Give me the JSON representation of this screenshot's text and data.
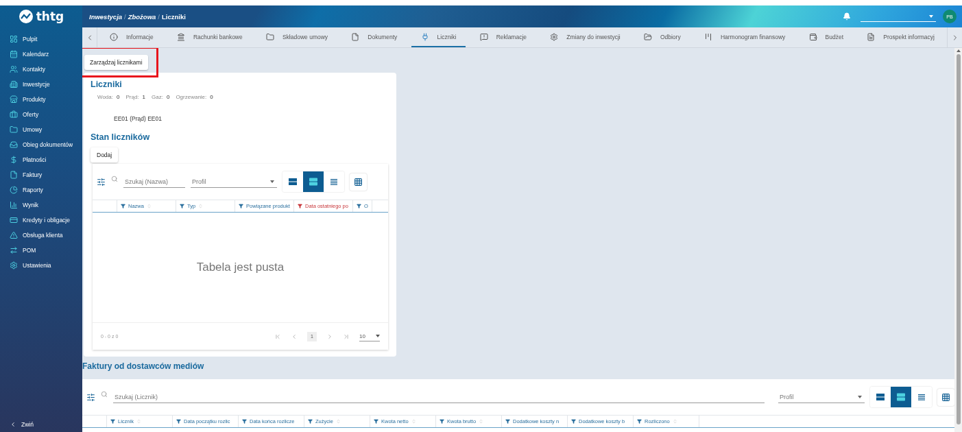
{
  "sidebar": {
    "logo": "thtg",
    "items": [
      {
        "label": "Pulpit"
      },
      {
        "label": "Kalendarz"
      },
      {
        "label": "Kontakty"
      },
      {
        "label": "Inwestycje"
      },
      {
        "label": "Produkty"
      },
      {
        "label": "Oferty"
      },
      {
        "label": "Umowy"
      },
      {
        "label": "Obieg dokumentów"
      },
      {
        "label": "Płatności"
      },
      {
        "label": "Faktury"
      },
      {
        "label": "Raporty"
      },
      {
        "label": "Wynik"
      },
      {
        "label": "Kredyty i obligacje"
      },
      {
        "label": "Obsługa klienta"
      },
      {
        "label": "POM"
      },
      {
        "label": "Ustawienia"
      }
    ],
    "collapse": "Zwiń"
  },
  "header": {
    "breadcrumbs": [
      {
        "label": "Inwestycja",
        "separator": "/"
      },
      {
        "label": "Zbożowa",
        "separator": "/"
      },
      {
        "label": "Liczniki"
      }
    ],
    "avatar": "PB"
  },
  "tabs": [
    {
      "label": "Informacje",
      "selected": false
    },
    {
      "label": "Rachunki bankowe",
      "selected": false
    },
    {
      "label": "Składowe umowy",
      "selected": false
    },
    {
      "label": "Dokumenty",
      "selected": false
    },
    {
      "label": "Liczniki",
      "selected": true
    },
    {
      "label": "Reklamacje",
      "selected": false
    },
    {
      "label": "Zmiany do inwestycji",
      "selected": false
    },
    {
      "label": "Odbiory",
      "selected": false
    },
    {
      "label": "Harmonogram finansowy",
      "selected": false
    },
    {
      "label": "Budżet",
      "selected": false
    },
    {
      "label": "Prospekt informacyj",
      "selected": false
    }
  ],
  "manage_button": {
    "label": "Zarządzaj licznikami",
    "highlighted": true
  },
  "meters_card": {
    "title": "Liczniki",
    "counts": [
      {
        "label": "Woda:",
        "value": "0"
      },
      {
        "label": "Prąd:",
        "value": "1"
      },
      {
        "label": "Gaz:",
        "value": "0"
      },
      {
        "label": "Ogrzewanie:",
        "value": "0"
      }
    ],
    "meter": "EE01 (Prąd) EE01",
    "state_title": "Stan liczników",
    "add_button": "Dodaj",
    "table": {
      "search_placeholder": "Szukaj (Nazwa)",
      "profile_placeholder": "Profil",
      "density": [
        {
          "selected": false
        },
        {
          "selected": true
        },
        {
          "selected": false
        }
      ],
      "columns": [
        {
          "label": "Nazwa",
          "sortable": true,
          "highlighted": false
        },
        {
          "label": "Typ",
          "sortable": true,
          "highlighted": false
        },
        {
          "label": "Powiązane produkt",
          "sortable": false,
          "highlighted": false
        },
        {
          "label": "Data ostatniego po",
          "sortable": false,
          "highlighted": true
        },
        {
          "label": "O",
          "sortable": false,
          "highlighted": false
        }
      ],
      "empty": "Tabela jest pusta",
      "range": "0 - 0 z 0",
      "page": "1",
      "page_size": "10"
    }
  },
  "invoices": {
    "title": "Faktury od dostawców mediów",
    "table": {
      "search_placeholder": "Szukaj (Licznik)",
      "profile_placeholder": "Profil",
      "density": [
        {
          "selected": false
        },
        {
          "selected": true
        },
        {
          "selected": false
        }
      ],
      "columns": [
        {
          "label": "Licznik",
          "sortable": true,
          "highlighted": false
        },
        {
          "label": "Data początku rozlic",
          "sortable": false,
          "highlighted": false
        },
        {
          "label": "Data końca rozlicze",
          "sortable": false,
          "highlighted": false
        },
        {
          "label": "Zużycie",
          "sortable": true,
          "highlighted": false
        },
        {
          "label": "Kwota netto",
          "sortable": true,
          "highlighted": false
        },
        {
          "label": "Kwota brutto",
          "sortable": true,
          "highlighted": false
        },
        {
          "label": "Dodatkowe koszty n",
          "sortable": false,
          "highlighted": false
        },
        {
          "label": "Dodatkowe koszty b",
          "sortable": false,
          "highlighted": false
        },
        {
          "label": "Rozliczono",
          "sortable": true,
          "highlighted": false
        }
      ]
    }
  }
}
